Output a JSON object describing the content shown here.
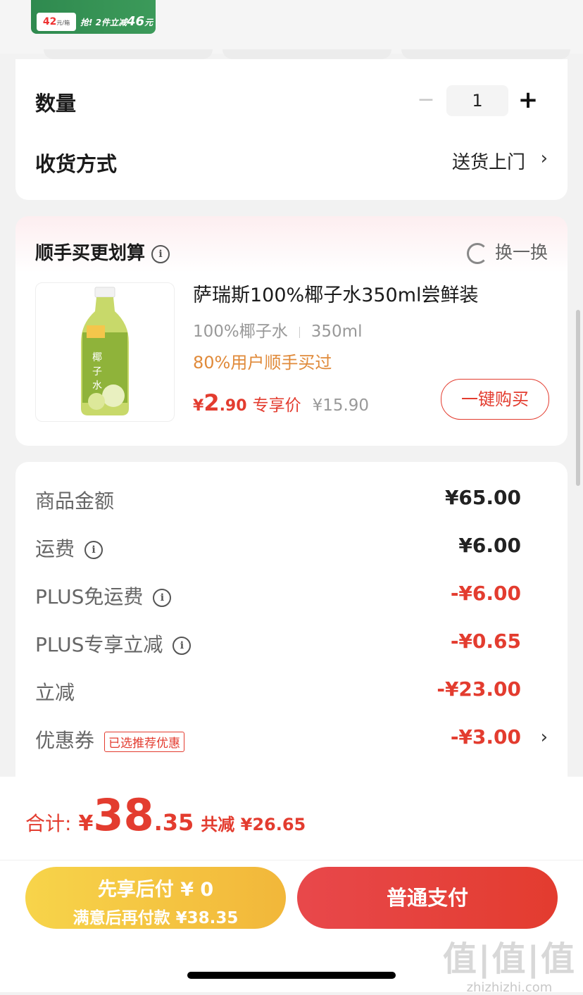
{
  "banner": {
    "price": "42",
    "price_unit": "元/箱",
    "deal_prefix": "抢! 2件立减",
    "deal_amount": "46",
    "deal_suffix": "元"
  },
  "order": {
    "quantity_label": "数量",
    "quantity_value": "1",
    "minus": "−",
    "plus": "+",
    "delivery_label": "收货方式",
    "delivery_value": "送货上门",
    "chevron": "›"
  },
  "addon": {
    "title": "顺手买更划算",
    "info": "i",
    "swap_label": "换一换",
    "product": {
      "name": "萨瑞斯100%椰子水350ml尝鲜装",
      "spec1": "100%椰子水",
      "spec2": "350ml",
      "bought": "80%用户顺手买过",
      "price_currency": "¥",
      "price_int": "2",
      "price_dec": ".90",
      "price_label": "专享价",
      "original_price": "¥15.90",
      "buy_label": "一键购买"
    }
  },
  "fees": [
    {
      "label": "商品金额",
      "value": "¥65.00",
      "info": false,
      "red": false
    },
    {
      "label": "运费",
      "value": "¥6.00",
      "info": true,
      "red": false
    },
    {
      "label": "PLUS免运费",
      "value": "-¥6.00",
      "info": true,
      "red": true
    },
    {
      "label": "PLUS专享立减",
      "value": "-¥0.65",
      "info": true,
      "red": true
    },
    {
      "label": "立减",
      "value": "-¥23.00",
      "info": false,
      "red": true
    },
    {
      "label": "优惠券",
      "value": "-¥3.00",
      "info": false,
      "red": true,
      "tag": "已选推荐优惠"
    }
  ],
  "total": {
    "label": "合计:",
    "currency": "¥",
    "int": "38",
    "dec": ".35",
    "saved": "共减 ¥26.65"
  },
  "pay": {
    "later_line1": "先享后付 ¥ 0",
    "later_line2": "满意后再付款 ¥38.35",
    "normal": "普通支付"
  },
  "watermark": {
    "logo": "值|值|值",
    "site": "zhizhizhi.com"
  },
  "colors": {
    "accent_red": "#e33c2f",
    "pay_later_yellow": "#f2b73a",
    "bought_orange": "#e08a3a"
  }
}
